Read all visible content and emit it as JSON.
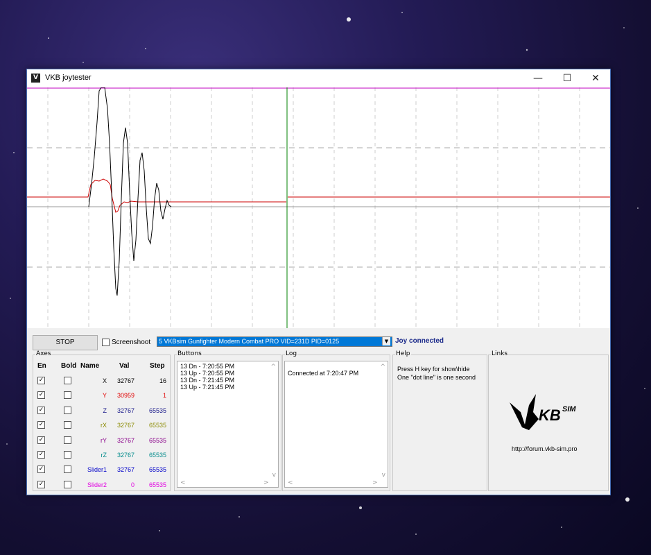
{
  "window": {
    "title": "VKB joytester",
    "minimize_glyph": "—",
    "maximize_glyph": "☐",
    "close_glyph": "✕"
  },
  "colors": {
    "trace_x": "#000000",
    "trace_y": "#cc0000",
    "cursor_line": "#008000",
    "top_line": "#c000c0",
    "grid": "#bbbbbb"
  },
  "controls": {
    "stop_label": "STOP",
    "screenshoot_label": "Screenshoot",
    "device_selected": "5 VKBsim Gunfighter Modern Combat PRO  VID=231D PID=0125",
    "status": "Joy connected"
  },
  "axes": {
    "group_label": "Axes",
    "headers": {
      "en": "En",
      "bold": "Bold",
      "name": "Name",
      "val": "Val",
      "step": "Step"
    },
    "rows": [
      {
        "en": true,
        "bold": false,
        "name": "X",
        "val": "32767",
        "step": "16",
        "color": "#000000"
      },
      {
        "en": true,
        "bold": false,
        "name": "Y",
        "val": "30959",
        "step": "1",
        "color": "#e00000"
      },
      {
        "en": true,
        "bold": false,
        "name": "Z",
        "val": "32767",
        "step": "65535",
        "color": "#1a1a8a"
      },
      {
        "en": true,
        "bold": false,
        "name": "rX",
        "val": "32767",
        "step": "65535",
        "color": "#8a8a00"
      },
      {
        "en": true,
        "bold": false,
        "name": "rY",
        "val": "32767",
        "step": "65535",
        "color": "#8a008a"
      },
      {
        "en": true,
        "bold": false,
        "name": "rZ",
        "val": "32767",
        "step": "65535",
        "color": "#008a8a"
      },
      {
        "en": true,
        "bold": false,
        "name": "Slider1",
        "val": "32767",
        "step": "65535",
        "color": "#0000c8"
      },
      {
        "en": true,
        "bold": false,
        "name": "Slider2",
        "val": "0",
        "step": "65535",
        "color": "#e000e0"
      }
    ]
  },
  "buttons_panel": {
    "label": "Buttons",
    "entries": [
      "13 Dn - 7:20:55 PM",
      "13 Up - 7:20:55 PM",
      "13 Dn - 7:21:45 PM",
      "13 Up - 7:21:45 PM"
    ]
  },
  "log_panel": {
    "label": "Log",
    "entries": [
      "Connected at 7:20:47 PM"
    ]
  },
  "help_panel": {
    "label": "Help",
    "lines": [
      "Press H key for show\\hide",
      "One \"dot line\" is one second"
    ]
  },
  "links_panel": {
    "label": "Links",
    "logo_text": "KB",
    "logo_sup": "SIM",
    "url": "http://forum.vkb-sim.pro"
  }
}
